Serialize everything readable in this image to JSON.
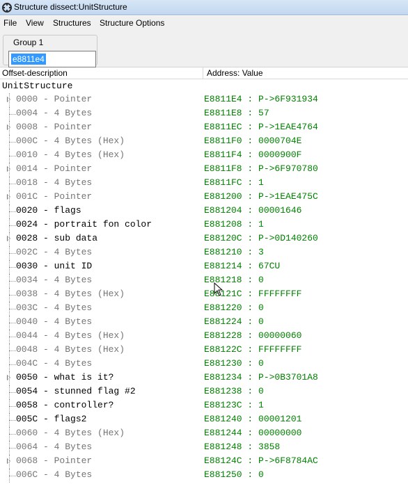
{
  "window": {
    "title": "Structure dissect:UnitStructure"
  },
  "menu": [
    "File",
    "View",
    "Structures",
    "Structure Options"
  ],
  "group": {
    "label": "Group 1",
    "address_value": "e8811e4"
  },
  "columns": {
    "offset": "Offset-description",
    "address": "Address: Value"
  },
  "root": "UnitStructure",
  "rows": [
    {
      "offset": "0000 - Pointer",
      "address": "E8811E4 : P->6F931934",
      "expandable": true,
      "user_named": false
    },
    {
      "offset": "0004 - 4 Bytes",
      "address": "E8811E8 : 57",
      "expandable": false,
      "user_named": false
    },
    {
      "offset": "0008 - Pointer",
      "address": "E8811EC : P->1EAE4764",
      "expandable": true,
      "user_named": false
    },
    {
      "offset": "000C - 4 Bytes (Hex)",
      "address": "E8811F0 : 0000704E",
      "expandable": false,
      "user_named": false
    },
    {
      "offset": "0010 - 4 Bytes (Hex)",
      "address": "E8811F4 : 0000900F",
      "expandable": false,
      "user_named": false
    },
    {
      "offset": "0014 - Pointer",
      "address": "E8811F8 : P->6F970780",
      "expandable": true,
      "user_named": false
    },
    {
      "offset": "0018 - 4 Bytes",
      "address": "E8811FC : 1",
      "expandable": false,
      "user_named": false
    },
    {
      "offset": "001C - Pointer",
      "address": "E881200 : P->1EAE475C",
      "expandable": true,
      "user_named": false
    },
    {
      "offset": "0020 - flags",
      "address": "E881204 : 00001646",
      "expandable": false,
      "user_named": true
    },
    {
      "offset": "0024 - portrait fon color",
      "address": "E881208 : 1",
      "expandable": false,
      "user_named": true
    },
    {
      "offset": "0028 - sub data",
      "address": "E88120C : P->0D140260",
      "expandable": true,
      "user_named": true
    },
    {
      "offset": "002C - 4 Bytes",
      "address": "E881210 : 3",
      "expandable": false,
      "user_named": false
    },
    {
      "offset": "0030 - unit ID",
      "address": "E881214 : 67CU",
      "expandable": false,
      "user_named": true
    },
    {
      "offset": "0034 - 4 Bytes",
      "address": "E881218 : 0",
      "expandable": false,
      "user_named": false
    },
    {
      "offset": "0038 - 4 Bytes (Hex)",
      "address": "E88121C : FFFFFFFF",
      "expandable": false,
      "user_named": false
    },
    {
      "offset": "003C - 4 Bytes",
      "address": "E881220 : 0",
      "expandable": false,
      "user_named": false
    },
    {
      "offset": "0040 - 4 Bytes",
      "address": "E881224 : 0",
      "expandable": false,
      "user_named": false
    },
    {
      "offset": "0044 - 4 Bytes (Hex)",
      "address": "E881228 : 00000060",
      "expandable": false,
      "user_named": false
    },
    {
      "offset": "0048 - 4 Bytes (Hex)",
      "address": "E88122C : FFFFFFFF",
      "expandable": false,
      "user_named": false
    },
    {
      "offset": "004C - 4 Bytes",
      "address": "E881230 : 0",
      "expandable": false,
      "user_named": false
    },
    {
      "offset": "0050 - what is it?",
      "address": "E881234 : P->0B3701A8",
      "expandable": true,
      "user_named": true
    },
    {
      "offset": "0054 - stunned flag #2",
      "address": "E881238 : 0",
      "expandable": false,
      "user_named": true
    },
    {
      "offset": "0058 - controller?",
      "address": "E88123C : 1",
      "expandable": false,
      "user_named": true
    },
    {
      "offset": "005C - flags2",
      "address": "E881240 : 00001201",
      "expandable": false,
      "user_named": true
    },
    {
      "offset": "0060 - 4 Bytes (Hex)",
      "address": "E881244 : 00000000",
      "expandable": false,
      "user_named": false
    },
    {
      "offset": "0064 - 4 Bytes",
      "address": "E881248 : 3858",
      "expandable": false,
      "user_named": false
    },
    {
      "offset": "0068 - Pointer",
      "address": "E88124C : P->6F8784AC",
      "expandable": true,
      "user_named": false
    },
    {
      "offset": "006C - 4 Bytes",
      "address": "E881250 : 0",
      "expandable": false,
      "user_named": false
    }
  ],
  "colors": {
    "address_text": "#008000",
    "default_label": "#757575",
    "named_label": "#000000",
    "selection": "#3399ff"
  }
}
